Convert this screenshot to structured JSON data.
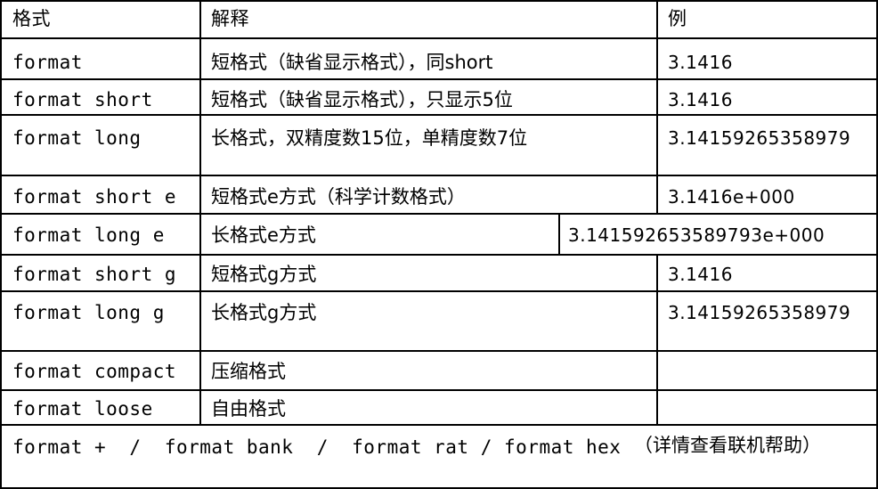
{
  "header": {
    "format": "格式",
    "explanation": "解释",
    "example": "例"
  },
  "rows": [
    {
      "format": "format",
      "explanation": "短格式（缺省显示格式），同short",
      "example": "3.1416"
    },
    {
      "format": "format short",
      "explanation": "短格式（缺省显示格式），只显示5位",
      "example": "3.1416"
    },
    {
      "format": "format long",
      "explanation": "长格式，双精度数15位，单精度数7位",
      "example": "3.14159265358979"
    },
    {
      "format": "format short e",
      "explanation": "短格式e方式（科学计数格式）",
      "example": "3.1416e+000"
    },
    {
      "format": "format long e",
      "explanation": "长格式e方式",
      "example": "3.141592653589793e+000"
    },
    {
      "format": "format short g",
      "explanation": "短格式g方式",
      "example": "3.1416"
    },
    {
      "format": "format long g",
      "explanation": "长格式g方式",
      "example": "3.14159265358979"
    },
    {
      "format": "format compact",
      "explanation": "压缩格式",
      "example": ""
    },
    {
      "format": "format loose",
      "explanation": "自由格式",
      "example": ""
    }
  ],
  "footer": {
    "formats": "format +  /  format bank  /  format rat / format hex",
    "note": "（详情查看联机帮助）"
  }
}
